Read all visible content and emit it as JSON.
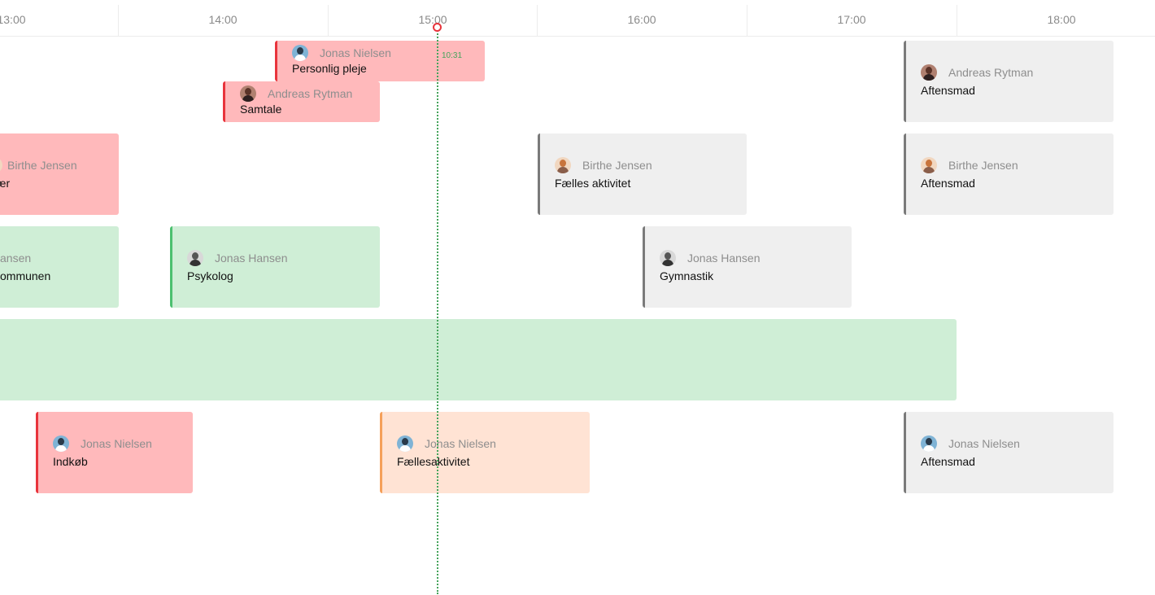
{
  "timeline": {
    "hours": [
      "13:00",
      "14:00",
      "15:00",
      "16:00",
      "17:00",
      "18:00"
    ],
    "current_time": "10:31"
  },
  "events": [
    {
      "person": "Jonas Nielsen",
      "title": "Personlig pleje",
      "status": "red",
      "avatar": "jonasn"
    },
    {
      "person": "Andreas Rytman",
      "title": "Samtale",
      "status": "red",
      "avatar": "andreas"
    },
    {
      "person": "Andreas Rytman",
      "title": "Aftensmad",
      "status": "gray",
      "avatar": "andreas"
    },
    {
      "person": "Birthe Jensen",
      "title": "ær",
      "status": "red",
      "avatar": ""
    },
    {
      "person": "Birthe Jensen",
      "title": "Fælles aktivitet",
      "status": "gray",
      "avatar": "birthe"
    },
    {
      "person": "Birthe Jensen",
      "title": "Aftensmad",
      "status": "gray",
      "avatar": "birthe"
    },
    {
      "person": "ansen",
      "title": "ommunen",
      "status": "green",
      "avatar": ""
    },
    {
      "person": "Jonas Hansen",
      "title": "Psykolog",
      "status": "green",
      "avatar": "jonash"
    },
    {
      "person": "Jonas Hansen",
      "title": "Gymnastik",
      "status": "gray",
      "avatar": "jonash"
    },
    {
      "person": "",
      "title": "",
      "status": "green",
      "avatar": ""
    },
    {
      "person": "Jonas Nielsen",
      "title": "Indkøb",
      "status": "red",
      "avatar": "jonasn"
    },
    {
      "person": "Jonas Nielsen",
      "title": "Fællesaktivitet",
      "status": "orange",
      "avatar": "jonasn"
    },
    {
      "person": "Jonas Nielsen",
      "title": "Aftensmad",
      "status": "gray",
      "avatar": "jonasn"
    }
  ],
  "colors": {
    "red": "#ffb9bb",
    "red_accent": "#e8343c",
    "green": "#cfeed6",
    "green_accent": "#4cc070",
    "orange": "#ffe3d4",
    "orange_accent": "#f5a05a",
    "gray": "#efefef",
    "gray_accent": "#7a7a7a",
    "now_line": "#44a35a"
  }
}
